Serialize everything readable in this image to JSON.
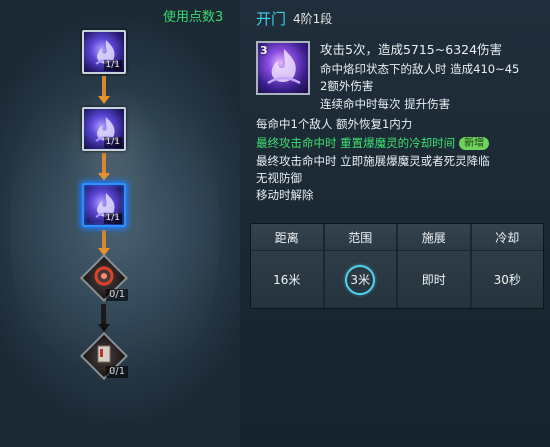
{
  "tree": {
    "points_label": "使用点数3",
    "nodes": [
      {
        "id": "node-1",
        "count": "1/1",
        "state": "learned"
      },
      {
        "id": "node-2",
        "count": "1/1",
        "state": "learned"
      },
      {
        "id": "node-3",
        "count": "1/1",
        "state": "selected"
      },
      {
        "id": "node-4",
        "count": "0/1",
        "state": "locked"
      },
      {
        "id": "node-5",
        "count": "0/1",
        "state": "locked"
      }
    ]
  },
  "skill": {
    "name": "开门",
    "rank": "4阶1段",
    "icon_number": "3",
    "lines": {
      "main": "攻击5次，造成5715~6324伤害",
      "l2": "命中烙印状态下的敌人时 造成410~45",
      "l3": "2额外伤害",
      "l4": "连续命中时每次 提升伤害",
      "l5": "每命中1个敌人 额外恢复1内力",
      "l6": "最终攻击命中时 重置爆魔灵的冷却时间",
      "l6_badge": "新增",
      "l7": "最终攻击命中时 立即施展爆魔灵或者死灵降临",
      "l8": "无视防御",
      "l9": "移动时解除"
    }
  },
  "stats": {
    "headers": [
      "距离",
      "范围",
      "施展",
      "冷却"
    ],
    "values": [
      "16米",
      "3米",
      "即时",
      "30秒"
    ]
  },
  "colors": {
    "accent_cyan": "#3fd0e8",
    "green_text": "#3de06e",
    "connector_orange": "#d9862c",
    "selected_border": "#2f8fff"
  }
}
